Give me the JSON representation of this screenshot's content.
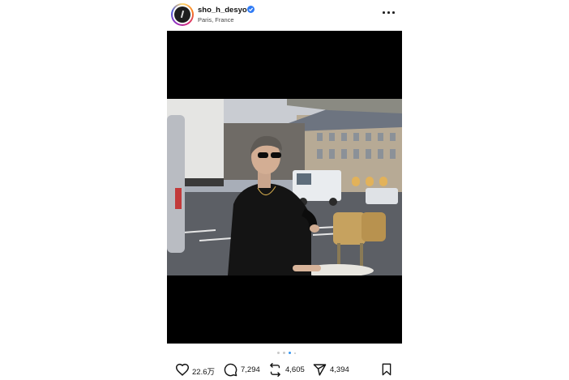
{
  "post": {
    "username": "sho_h_desyo",
    "verified": true,
    "location": "Paris, France",
    "carousel": {
      "total": 4,
      "current": 3
    },
    "actions": {
      "likes": "22.6万",
      "comments": "7,294",
      "reposts": "4,605",
      "shares": "4,394"
    },
    "icons": [
      "heart-icon",
      "comment-icon",
      "repost-icon",
      "share-icon",
      "bookmark-icon",
      "more-icon",
      "verified-badge-icon"
    ]
  },
  "colors": {
    "verified": "#2f7bf5",
    "carousel_active": "#3897f0",
    "carousel_inactive": "#c8c8c8"
  }
}
